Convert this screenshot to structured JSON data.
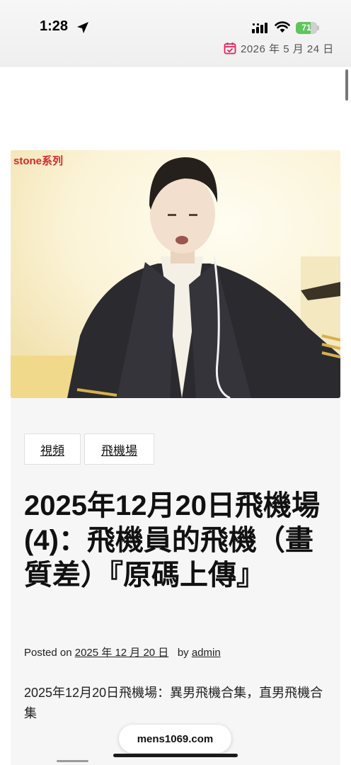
{
  "status_bar": {
    "time": "1:28",
    "battery_level": "71",
    "icons": [
      "location-arrow-icon",
      "cellular-signal-icon",
      "wifi-icon",
      "battery-icon"
    ]
  },
  "header": {
    "date": "2026 年 5 月 24 日",
    "date_icon": "calendar-check-icon",
    "accent_color": "#e0245e"
  },
  "article": {
    "video_watermark": "stone系列",
    "tags": [
      "視頻",
      "飛機場"
    ],
    "title": "2025年12月20日飛機場(4)：飛機員的飛機（畫質差）『原碼上傳』",
    "meta": {
      "posted_on_label": "Posted on",
      "date": "2025 年 12 月 20 日",
      "by_label": "by",
      "author": "admin"
    },
    "excerpt": "2025年12月20日飛機場：異男飛機合集，直男飛機合集"
  },
  "browser": {
    "url": "mens1069.com"
  }
}
